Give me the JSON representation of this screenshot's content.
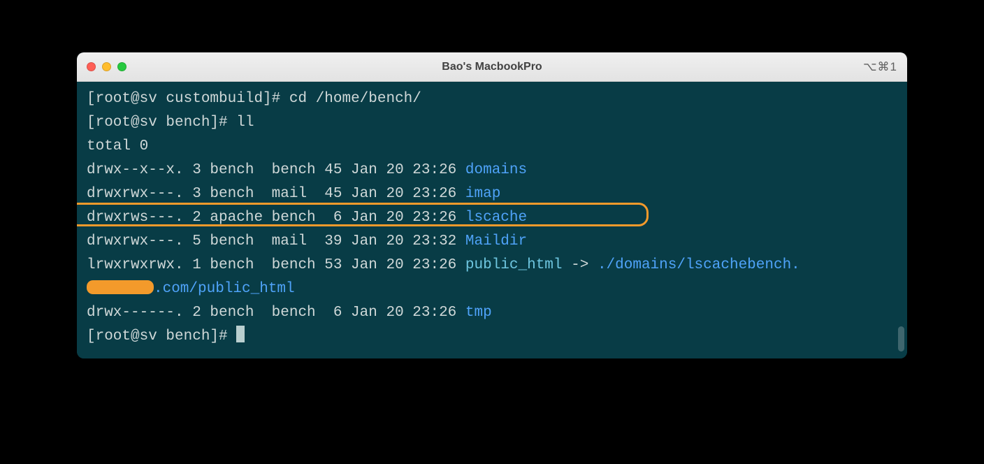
{
  "window": {
    "title": "Bao's MacbookPro",
    "shortcut": "⌥⌘1"
  },
  "term": {
    "prompt1_prefix": "[root@sv custombuild]# ",
    "cmd1": "cd /home/bench/",
    "prompt2_prefix": "[root@sv bench]# ",
    "cmd2": "ll",
    "total": "total 0",
    "rows": [
      {
        "meta": "drwx--x--x. 3 bench  bench 45 Jan 20 23:26 ",
        "name": "domains",
        "color": "blue"
      },
      {
        "meta": "drwxrwx---. 3 bench  mail  45 Jan 20 23:26 ",
        "name": "imap",
        "color": "blue"
      },
      {
        "meta": "drwxrws---. 2 apache bench  6 Jan 20 23:26 ",
        "name": "lscache",
        "color": "blue"
      },
      {
        "meta": "drwxrwx---. 5 bench  mail  39 Jan 20 23:32 ",
        "name": "Maildir",
        "color": "blue"
      }
    ],
    "symlink": {
      "meta": "lrwxrwxrwx. 1 bench  bench 53 Jan 20 23:26 ",
      "name": "public_html",
      "arrow": " -> ",
      "target": "./domains/lscachebench.",
      "cont_suffix": ".com/public_html"
    },
    "row_tmp": {
      "meta": "drwx------. 2 bench  bench  6 Jan 20 23:26 ",
      "name": "tmp"
    },
    "prompt3_prefix": "[root@sv bench]# "
  }
}
